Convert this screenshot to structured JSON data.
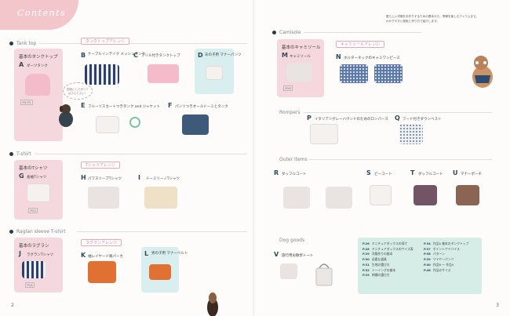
{
  "header": {
    "title": "Contents"
  },
  "left_page": {
    "page_number": "2",
    "sections": [
      {
        "key": "tanktop",
        "label": "Tank top"
      },
      {
        "key": "tshirt",
        "label": "T-shirt"
      },
      {
        "key": "raglan",
        "label": "Raglan sleeve T-shirt"
      }
    ],
    "arrange_labels": [
      "タンクトップアレンジ",
      "Tシャツアレンジ",
      "ラグランアレンジ"
    ],
    "basic_cards": [
      {
        "title": "基本のタンクトップ",
        "letter": "A",
        "name": "ダーツタンク",
        "pages": "P4  P3",
        "note": "型紙にしたがって\nはさんでよい！"
      },
      {
        "title": "基本のTシャツ",
        "letter": "G",
        "name": "長袖Tシャツ",
        "pages": "P10"
      },
      {
        "title": "基本のラグラン",
        "letter": "J",
        "name": "ラグランTシャツ",
        "pages": "P14"
      }
    ],
    "items": [
      {
        "letter": "B",
        "name": "ケーブルインテイク\nメッシュタンク"
      },
      {
        "letter": "C",
        "name": "フリル付きタンクトップ"
      },
      {
        "letter": "D",
        "name": "あの子用\nマナーパンツ"
      },
      {
        "letter": "E",
        "name": "フルーツスカートつきタンク and ジャケット"
      },
      {
        "letter": "F",
        "name": "パンツつきオールドーミとタンク"
      },
      {
        "letter": "H",
        "name": "パフスリーブTシャツ"
      },
      {
        "letter": "I",
        "name": "ドーミリーノTシャツ"
      },
      {
        "letter": "K",
        "name": "袖レイヤード風パーカ"
      },
      {
        "letter": "L",
        "name": "男の子用\nマナーベルト"
      }
    ]
  },
  "right_page": {
    "page_number": "3",
    "intro": "愛らしい洋服を手作りするための基本から、季節を楽しむアイテムまで、わかりやすい型紙と作り方で紹介します。",
    "sections": [
      {
        "key": "camisole",
        "label": "Camisole"
      },
      {
        "key": "rompers",
        "label": "Rompers"
      },
      {
        "key": "outer",
        "label": "Outer items"
      },
      {
        "key": "goods",
        "label": "Dog goods"
      }
    ],
    "arrange_labels": [
      "キャミソールアレンジ"
    ],
    "basic_cards": [
      {
        "title": "基本のキャミソール",
        "letter": "M",
        "name": "キャミソール",
        "pages": "P16"
      }
    ],
    "items": [
      {
        "letter": "N",
        "name": "ホルターネックのキャミワンピース"
      },
      {
        "letter": "O",
        "name": "フレンチ スリーブのあわせのロンパース"
      },
      {
        "letter": "P",
        "name": "イタリアングレーハウンドのためのロンパース"
      },
      {
        "letter": "Q",
        "name": "フード付きダウンベスト"
      },
      {
        "letter": "R",
        "name": "ダッフルコート"
      },
      {
        "letter": "S",
        "name": "ピーコート"
      },
      {
        "letter": "T",
        "name": "ダッフルコート"
      },
      {
        "letter": "U",
        "name": "マナーポーチ"
      },
      {
        "letter": "V",
        "name": "旅行用お散歩トート"
      }
    ],
    "toc_left": [
      {
        "page": "P.26",
        "text": "ミニチュアダックスの採寸"
      },
      {
        "page": "P.28",
        "text": "ミニチュアダックスのサイズ表"
      },
      {
        "page": "P.29",
        "text": "洋服作りの基本"
      },
      {
        "page": "P.30",
        "text": "必要な道具"
      },
      {
        "page": "P.31",
        "text": "生地の選び方"
      },
      {
        "page": "P.32",
        "text": "ソーイングの基本"
      },
      {
        "page": "P.33",
        "text": "刺繍の選び方"
      }
    ],
    "toc_right": [
      {
        "page": "P.34",
        "text": "作品A 基本のタンクトップ"
      },
      {
        "page": "P.37",
        "text": "ポイントアドバイス"
      },
      {
        "page": "P.38",
        "text": "パターン"
      },
      {
        "page": "P.39",
        "text": "ワイヤーパンツ"
      },
      {
        "page": "P.40",
        "text": "作品B 〜 作品V"
      },
      {
        "page": "P.46",
        "text": "作品のサイズ"
      }
    ]
  }
}
